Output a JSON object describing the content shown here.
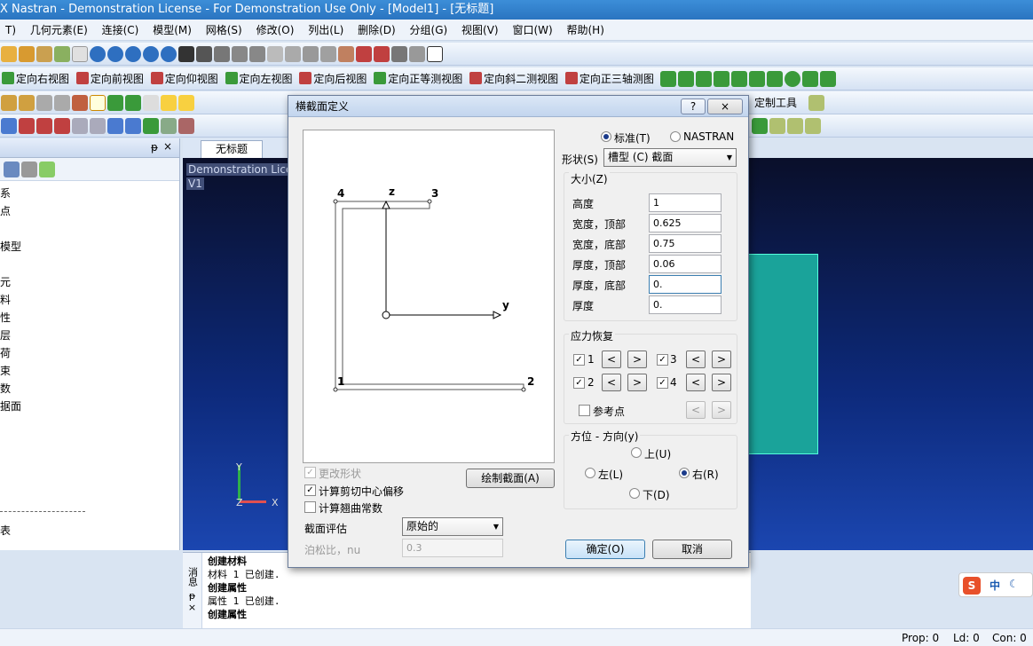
{
  "window": {
    "title": "X Nastran - Demonstration License - For Demonstration Use Only - [Model1] - [无标题]"
  },
  "menu": [
    "T)",
    "几何元素(E)",
    "连接(C)",
    "模型(M)",
    "网格(S)",
    "修改(O)",
    "列出(L)",
    "删除(D)",
    "分组(G)",
    "视图(V)",
    "窗口(W)",
    "帮助(H)"
  ],
  "view_toolbar": [
    "定向右视图",
    "定向前视图",
    "定向仰视图",
    "定向左视图",
    "定向后视图",
    "定向正等测视图",
    "定向斜二测视图",
    "定向正三轴测图"
  ],
  "custom_tools_label": "定制工具",
  "tab": {
    "label": "无标题"
  },
  "left_panel": {
    "pin_icon": "pin-icon",
    "close_icon": "close-icon",
    "items": [
      "系",
      "点",
      "",
      "模型",
      "",
      "元",
      "料",
      "性",
      "层",
      "荷",
      "束",
      "数",
      "据面"
    ],
    "bottom_item": "表"
  },
  "viewport": {
    "watermark": "Demonstration Lice",
    "view_label": "V1",
    "axis_y": "Y",
    "axis_z": "Z",
    "axis_x": "X"
  },
  "messages": [
    {
      "text": "创建材料",
      "bold": true
    },
    {
      "text": "材料 1 已创建.",
      "bold": false
    },
    {
      "text": "创建属性",
      "bold": true
    },
    {
      "text": "属性 1 已创建.",
      "bold": false
    },
    {
      "text": "创建属性",
      "bold": true
    }
  ],
  "message_side": {
    "label": "消息",
    "pin": "ᵽ",
    "close": "×"
  },
  "status": {
    "prop": "Prop: 0",
    "ld": "Ld: 0",
    "con": "Con: 0"
  },
  "ime": {
    "label": "中"
  },
  "dialog": {
    "title": "横截面定义",
    "help_btn": "?",
    "close_btn": "×",
    "std_radio": "标准(T)",
    "nastran_radio": "NASTRAN",
    "shape_label": "形状(S)",
    "shape_value": "槽型 (C) 截面",
    "size_group": "大小(Z)",
    "fields": [
      {
        "label": "高度",
        "value": "1"
      },
      {
        "label": "宽度，顶部",
        "value": "0.625"
      },
      {
        "label": "宽度，底部",
        "value": "0.75"
      },
      {
        "label": "厚度，顶部",
        "value": "0.06"
      },
      {
        "label": "厚度，底部",
        "value": "0."
      },
      {
        "label": "厚度",
        "value": "0."
      }
    ],
    "stress_group": "应力恢复",
    "stress_points": [
      "1",
      "2",
      "3",
      "4"
    ],
    "ref_point": "参考点",
    "orient_group": "方位 - 方向(y)",
    "orient": {
      "up": "上(U)",
      "left": "左(L)",
      "right": "右(R)",
      "down": "下(D)"
    },
    "sketch": {
      "p1": "1",
      "p2": "2",
      "p3": "3",
      "p4": "4",
      "z": "z",
      "y": "y"
    },
    "change_shape": "更改形状",
    "calc_shear": "计算剪切中心偏移",
    "calc_warp": "计算翘曲常数",
    "draw_btn": "绘制截面(A)",
    "eval_label": "截面评估",
    "eval_value": "原始的",
    "poisson_label": "泊松比，nu",
    "poisson_value": "0.3",
    "ok": "确定(O)",
    "cancel": "取消"
  }
}
